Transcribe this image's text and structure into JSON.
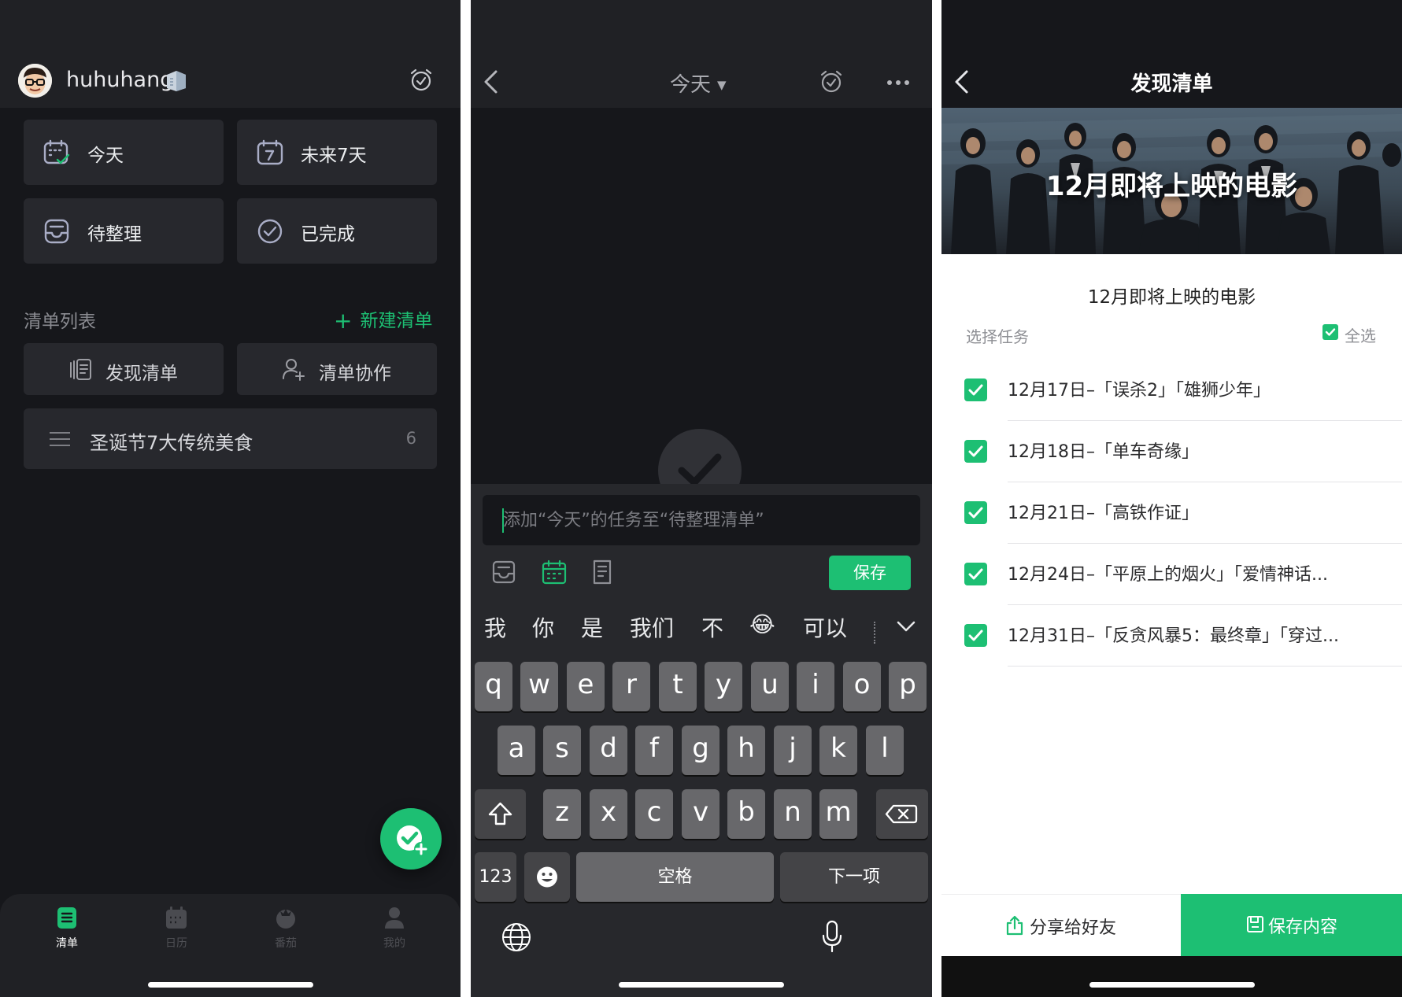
{
  "panel1": {
    "username": "huhuhang",
    "tiles": [
      {
        "label": "今天",
        "icon": "calendar-check-icon"
      },
      {
        "label": "未来7天",
        "icon": "calendar-7-icon"
      },
      {
        "label": "待整理",
        "icon": "inbox-icon"
      },
      {
        "label": "已完成",
        "icon": "check-circle-icon"
      }
    ],
    "section_title": "清单列表",
    "new_list": "新建清单",
    "discover_list": "发现清单",
    "collab_list": "清单协作",
    "lists": [
      {
        "title": "圣诞节7大传统美食",
        "count": "6"
      }
    ],
    "tabs": [
      {
        "label": "清单",
        "active": true
      },
      {
        "label": "日历",
        "active": false
      },
      {
        "label": "番茄",
        "active": false
      },
      {
        "label": "我的",
        "active": false
      }
    ],
    "accent": "#1dbf73"
  },
  "panel2": {
    "title": "今天",
    "input_placeholder": "添加“今天”的任务至“待整理清单”",
    "save": "保存",
    "suggestions": [
      "我",
      "你",
      "是",
      "我们",
      "不",
      "😂",
      "可以"
    ],
    "keyboard": {
      "row1": [
        "q",
        "w",
        "e",
        "r",
        "t",
        "y",
        "u",
        "i",
        "o",
        "p"
      ],
      "row2": [
        "a",
        "s",
        "d",
        "f",
        "g",
        "h",
        "j",
        "k",
        "l"
      ],
      "row3": [
        "z",
        "x",
        "c",
        "v",
        "b",
        "n",
        "m"
      ],
      "numbers": "123",
      "space": "空格",
      "next": "下一项"
    }
  },
  "panel3": {
    "title": "发现清单",
    "banner_text": "12月即将上映的电影",
    "subtitle": "12月即将上映的电影",
    "select_hint": "选择任务",
    "select_all": "全选",
    "items": [
      "12月17日–「误杀2」「雄狮少年」",
      "12月18日–「单车奇缘」",
      "12月21日–「高铁作证」",
      "12月24日–「平原上的烟火」「爱情神话...",
      "12月31日–「反贪风暴5：最终章」「穿过..."
    ],
    "share": "分享给好友",
    "save_content": "保存内容"
  }
}
